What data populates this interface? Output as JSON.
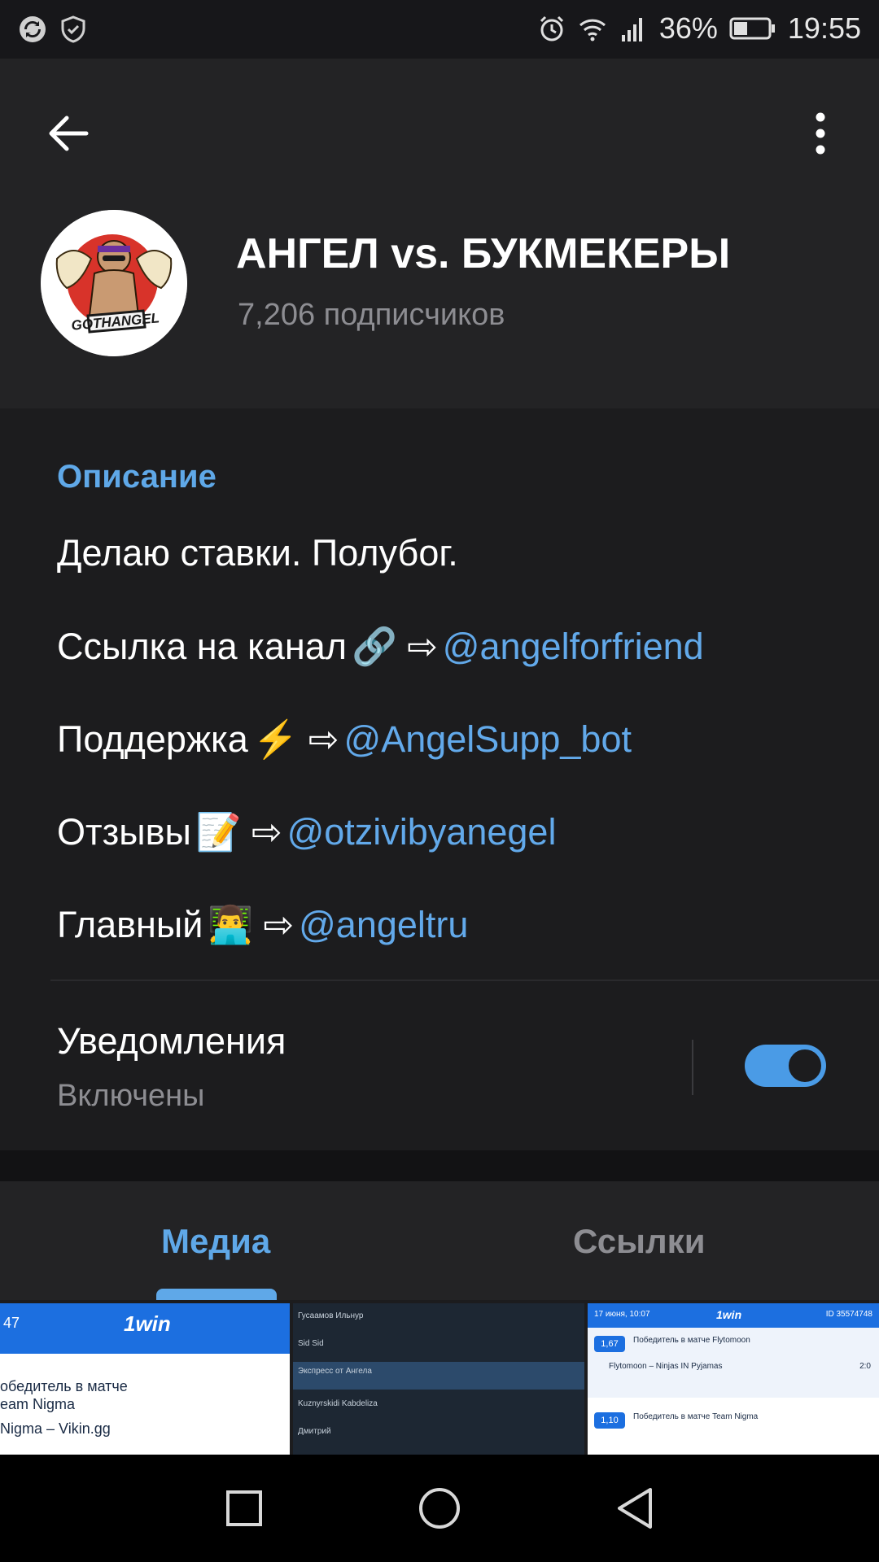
{
  "status_bar": {
    "battery": "36%",
    "time": "19:55"
  },
  "channel": {
    "name": "АНГЕЛ vs. БУКМЕКЕРЫ",
    "subscribers": "7,206 подписчиков",
    "avatar_text": "GOTHANGEL"
  },
  "description": {
    "title": "Описание",
    "tagline": "Делаю ставки. Полубог.",
    "lines": [
      {
        "label": "Ссылка на канал",
        "emoji": "🔗",
        "arrow": "⇨",
        "link": "@angelforfriend"
      },
      {
        "label": "Поддержка",
        "emoji": "⚡",
        "arrow": "⇨",
        "link": "@AngelSupp_bot"
      },
      {
        "label": "Отзывы",
        "emoji": "📝",
        "arrow": "⇨",
        "link": "@otzivibyanegel"
      },
      {
        "label": "Главный",
        "emoji": "👨‍💻",
        "arrow": "⇨",
        "link": "@angeltru"
      }
    ]
  },
  "notifications": {
    "title": "Уведомления",
    "status": "Включены",
    "enabled": true
  },
  "tabs": {
    "media": "Медиа",
    "links": "Ссылки",
    "active": "media"
  },
  "media_thumbs": [
    {
      "brand": "1win",
      "header": "47",
      "line1": "обедитель в матче",
      "line2": "eam Nigma",
      "line3": "Nigma – Vikin.gg"
    },
    {
      "chat": [
        "Гусаамов Ильнур",
        "Sid Sid",
        "Экспресс от Ангела",
        "Kuznyrskidi Kabdeliza",
        "Дмитрий"
      ]
    },
    {
      "brand": "1win",
      "date": "17 июня, 10:07",
      "id": "ID 35574748",
      "odds1": "1,67",
      "pick1": "Победитель в матче Flytomoon",
      "match1": "Flytomoon – Ninjas IN Pyjamas",
      "score1": "2:0",
      "odds2": "1,10",
      "pick2": "Победитель в матче Team Nigma"
    }
  ],
  "colors": {
    "accent": "#5fa8e8",
    "link": "#62a9ea",
    "background": "#1c1c1e",
    "header_bg": "#232325"
  }
}
